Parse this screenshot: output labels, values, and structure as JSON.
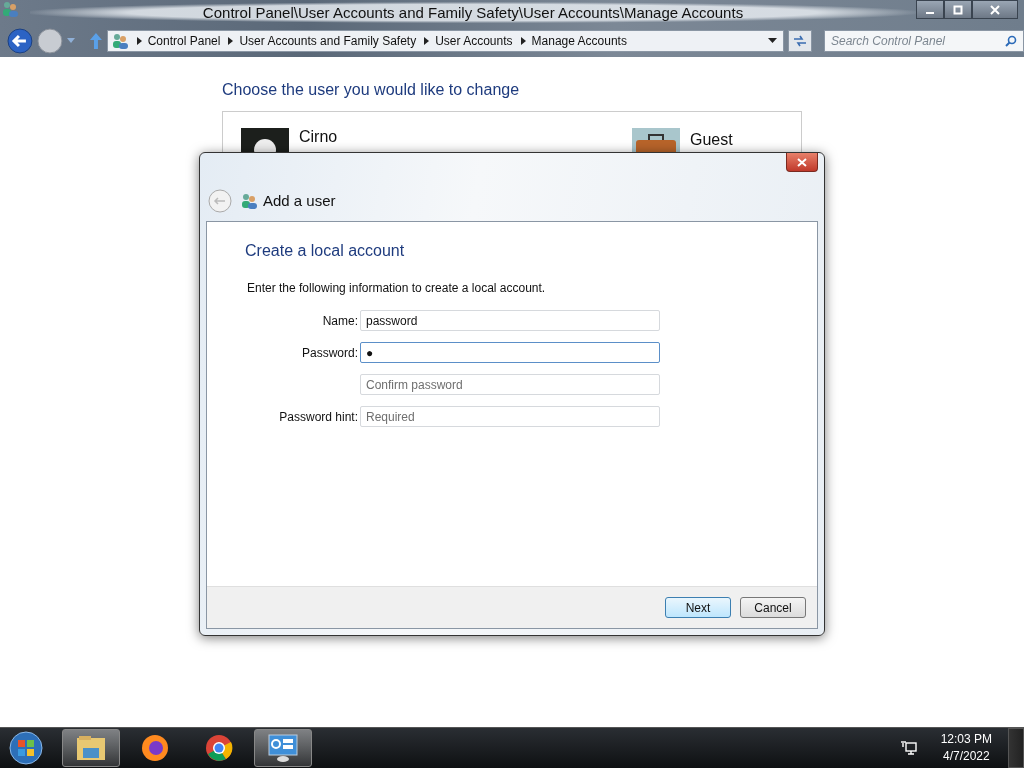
{
  "window": {
    "title": "Control Panel\\User Accounts and Family Safety\\User Accounts\\Manage Accounts"
  },
  "breadcrumbs": [
    "Control Panel",
    "User Accounts and Family Safety",
    "User Accounts",
    "Manage Accounts"
  ],
  "search": {
    "placeholder": "Search Control Panel"
  },
  "page": {
    "heading": "Choose the user you would like to change",
    "users": [
      {
        "name": "Cirno",
        "kind": "person"
      },
      {
        "name": "Guest",
        "kind": "briefcase"
      }
    ]
  },
  "dialog": {
    "title": "Add a user",
    "heading": "Create a local account",
    "instructions": "Enter the following information to create a local account.",
    "fields": [
      {
        "label": "Name:",
        "value": "password",
        "focused": false
      },
      {
        "label": "Password:",
        "value": "●",
        "focused": true
      },
      {
        "placeholder": "Confirm password",
        "focused": false
      },
      {
        "label": "Password hint:",
        "placeholder": "Required",
        "focused": false
      }
    ],
    "buttons": [
      {
        "label": "Next",
        "default": true
      },
      {
        "label": "Cancel",
        "default": false
      }
    ]
  },
  "taskbar": {
    "apps": [
      {
        "kind": "explorer",
        "active": true
      },
      {
        "kind": "firefox",
        "active": false
      },
      {
        "kind": "chrome",
        "active": false
      },
      {
        "kind": "control-panel",
        "active": true
      }
    ],
    "clock": {
      "time": "12:03 PM",
      "date": "4/7/2022"
    }
  }
}
